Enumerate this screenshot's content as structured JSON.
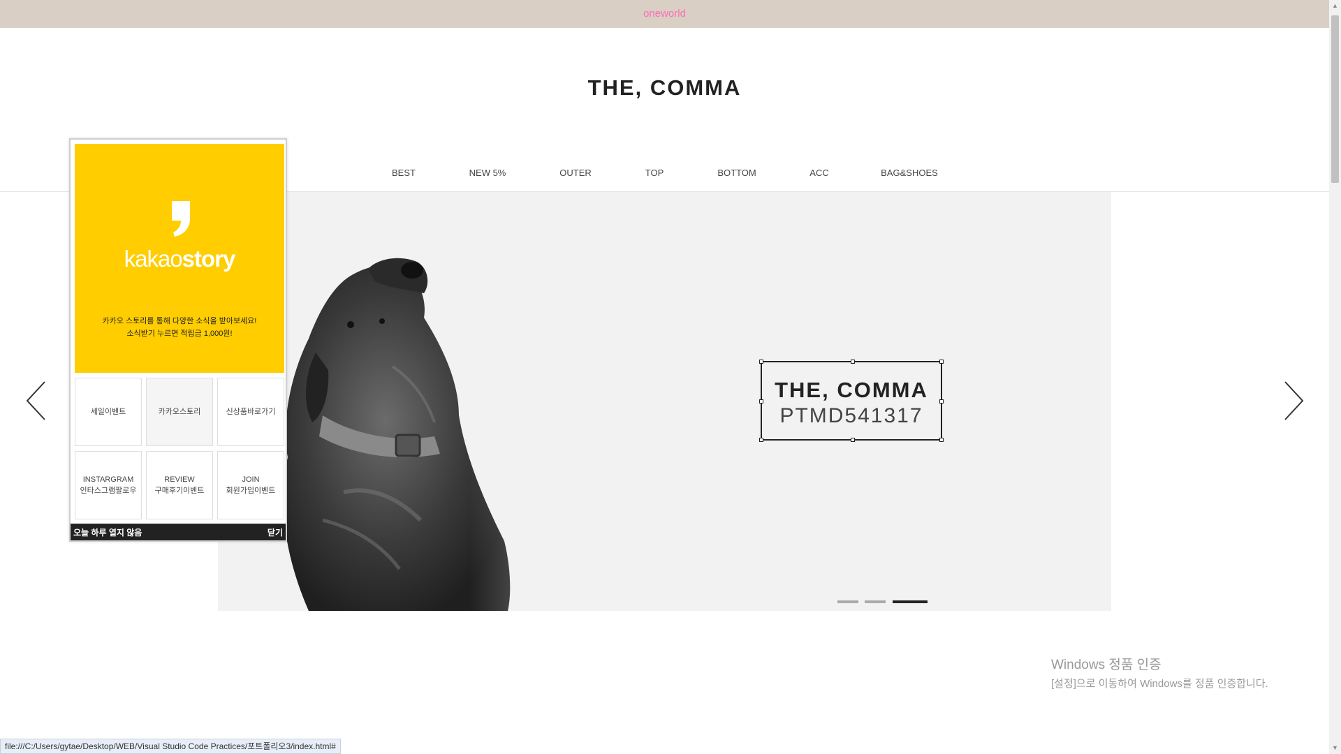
{
  "topbar": {
    "text": "oneworld",
    "text_color": "#ff6eb4",
    "bg_color": "#d9cfc5"
  },
  "header": {
    "logo": "THE, COMMA"
  },
  "nav": {
    "items": [
      "BEST",
      "NEW 5%",
      "OUTER",
      "TOP",
      "BOTTOM",
      "ACC",
      "BAG&SHOES"
    ]
  },
  "slider": {
    "caption_title": "THE, COMMA",
    "caption_code": "PTMD541317",
    "active_slide": 3,
    "slide_count": 3,
    "prev_icon": "chevron-left-icon",
    "next_icon": "chevron-right-icon"
  },
  "popup": {
    "brand_light": "kakao",
    "brand_bold": "story",
    "brand_color": "#ffcd00",
    "message_line1": "카카오 스토리를 통해 다양한 소식을 받아보세요!",
    "message_line2": "소식받기 누르면 적립금 1,000원!",
    "grid": [
      {
        "line1": "세일이벤트",
        "line2": ""
      },
      {
        "line1": "카카오스토리",
        "line2": ""
      },
      {
        "line1": "신상품바로가기",
        "line2": ""
      },
      {
        "line1": "INSTARGRAM",
        "line2": "인타스그램팔로우"
      },
      {
        "line1": "REVIEW",
        "line2": "구매후기이벤트"
      },
      {
        "line1": "JOIN",
        "line2": "회원가입이벤트"
      }
    ],
    "dismiss_today": "오늘 하루 열지 않음",
    "close": "닫기"
  },
  "activation": {
    "title": "Windows 정품 인증",
    "desc": "[설정]으로 이동하여 Windows를 정품 인증합니다."
  },
  "statusbar": {
    "url": "file:///C:/Users/gytae/Desktop/WEB/Visual Studio Code Practices/포트폴리오3/index.html#"
  }
}
